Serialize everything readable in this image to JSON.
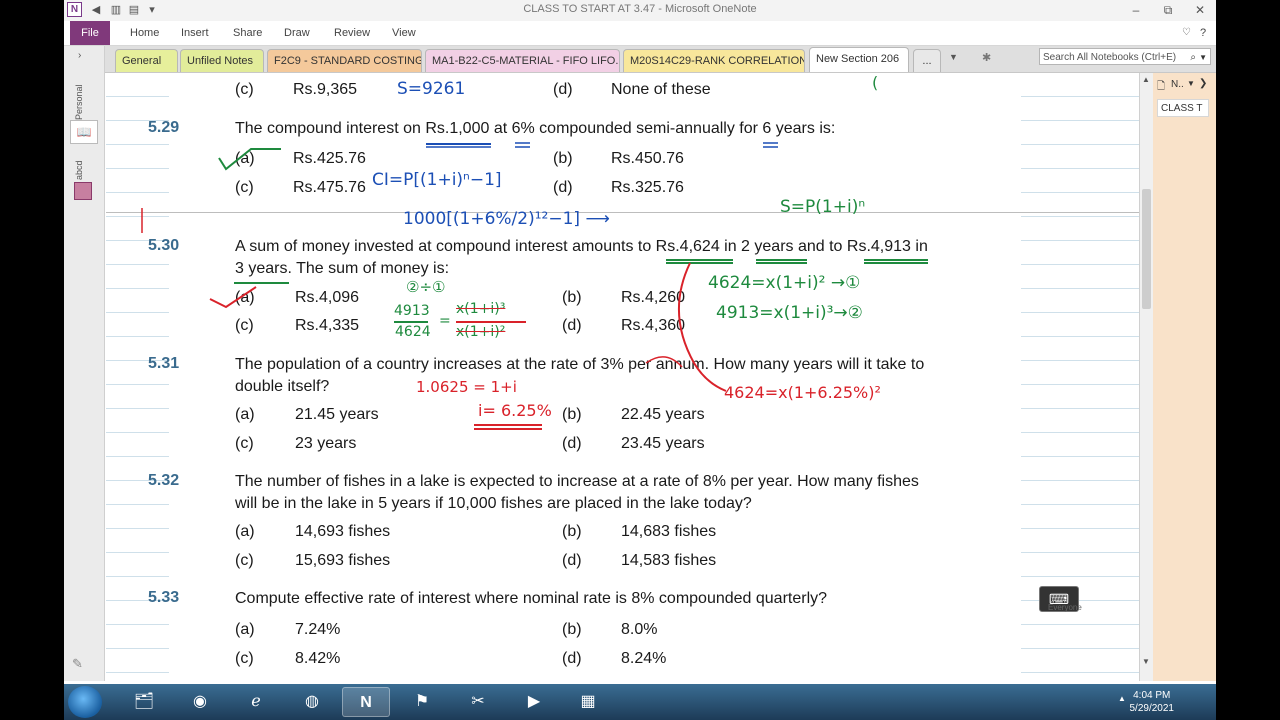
{
  "window": {
    "title": "CLASS TO START AT 3.47  -  Microsoft OneNote",
    "minimize": "–",
    "restore": "⧉",
    "close": "✕"
  },
  "ribbon": {
    "file": "File",
    "tabs": [
      "Home",
      "Insert",
      "Share",
      "Draw",
      "Review",
      "View"
    ]
  },
  "sections": {
    "tabs": [
      {
        "label": "General",
        "color": "#e6ef9b"
      },
      {
        "label": "Unfiled Notes",
        "color": "#e2ec9a"
      },
      {
        "label": "F2C9 - STANDARD COSTING",
        "color": "#f4c99b"
      },
      {
        "label": "MA1-B22-C5-MATERIAL - FIFO LIFO...",
        "color": "#f2d0e5"
      },
      {
        "label": "M20S14C29-RANK CORRELATION",
        "color": "#f8e79b"
      },
      {
        "label": "New Section 206",
        "color": "#ffffff"
      }
    ],
    "more": "...",
    "search_placeholder": "Search All Notebooks (Ctrl+E)"
  },
  "nav": {
    "personal": "Personal",
    "abcd": "abcd"
  },
  "right_pane": {
    "page_dropdown": "N..",
    "page_item": "CLASS T"
  },
  "content": {
    "q528": {
      "c_label": "(c)",
      "c": "Rs.9,365",
      "d_label": "(d)",
      "d": "None of these"
    },
    "q529": {
      "num": "5.29",
      "text": "The compound interest on Rs.1,000 at 6% compounded semi-annually for 6 years is:",
      "a_label": "(a)",
      "a": "Rs.425.76",
      "b_label": "(b)",
      "b": "Rs.450.76",
      "c_label": "(c)",
      "c": "Rs.475.76",
      "d_label": "(d)",
      "d": "Rs.325.76"
    },
    "q530": {
      "num": "5.30",
      "text1": "A sum of money invested at compound interest amounts to Rs.4,624 in 2 years and to Rs.4,913 in",
      "text2": "3 years. The sum of money is:",
      "a_label": "(a)",
      "a": "Rs.4,096",
      "b_label": "(b)",
      "b": "Rs.4,260",
      "c_label": "(c)",
      "c": "Rs.4,335",
      "d_label": "(d)",
      "d": "Rs.4,360"
    },
    "q531": {
      "num": "5.31",
      "text1": "The population of a country increases at the rate of 3% per annum. How many years will it take to",
      "text2": "double itself?",
      "a_label": "(a)",
      "a": "21.45 years",
      "b_label": "(b)",
      "b": "22.45 years",
      "c_label": "(c)",
      "c": "23 years",
      "d_label": "(d)",
      "d": "23.45 years"
    },
    "q532": {
      "num": "5.32",
      "text1": "The number of fishes in a lake is expected to increase at a rate of 8% per year. How many fishes",
      "text2": "will be in the lake in 5 years if 10,000 fishes are placed in the lake today?",
      "a_label": "(a)",
      "a": "14,693 fishes",
      "b_label": "(b)",
      "b": "14,683 fishes",
      "c_label": "(c)",
      "c": "15,693 fishes",
      "d_label": "(d)",
      "d": "14,583 fishes"
    },
    "q533": {
      "num": "5.33",
      "text": "Compute effective rate of interest where nominal rate is 8% compounded quarterly?",
      "a_label": "(a)",
      "a": "7.24%",
      "b_label": "(b)",
      "b": "8.0%",
      "c_label": "(c)",
      "c": "8.42%",
      "d_label": "(d)",
      "d": "8.24%"
    }
  },
  "ink": {
    "s_9261": "S=9261",
    "ci_formula": "CI=P[(1+i)ⁿ−1]",
    "ci_calc": "1000[(1+6%/2)¹²−1] ⟶",
    "s_formula": "S=P(1+i)ⁿ",
    "eq1": "4624=x(1+i)² →①",
    "eq2": "4913=x(1+i)³→②",
    "div": "②÷①",
    "frac_num": "4913",
    "frac_den": "4624",
    "frac_eq": "=",
    "frac_rhs_num": "x(1+i)³",
    "frac_rhs_den": "x(1+i)²",
    "onepluI": "1.0625 = 1+i",
    "i_val": "i= 6.25%",
    "sub": "4624=x(1+6.25%)²"
  },
  "keyboard": {
    "label": "Everyone"
  },
  "taskbar": {
    "time": "4:04 PM",
    "date": "5/29/2021"
  }
}
